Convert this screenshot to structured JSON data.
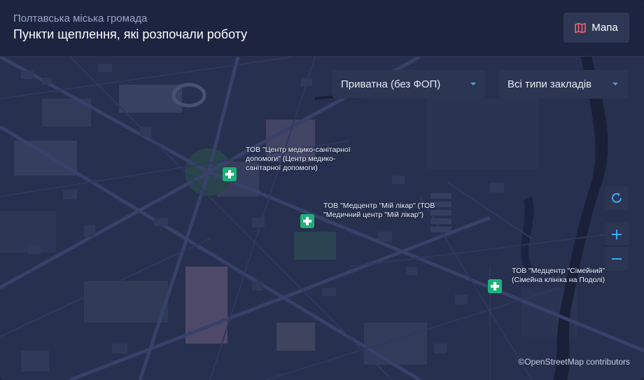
{
  "header": {
    "subtitle": "Полтавська міська громада",
    "title": "Пункти щеплення, які розпочали роботу",
    "map_button_label": "Мапа"
  },
  "filters": {
    "ownership": "Приватна (без ФОП)",
    "facility_type": "Всі типи закладів"
  },
  "markers": [
    {
      "icon": "medical-cross-icon",
      "label": "ТОВ \"Центр медико-санітарної допомоги\" (Центр медико-санітарної допомоги)"
    },
    {
      "icon": "medical-cross-icon",
      "label": "ТОВ \"Медцентр \"Мій лікар\" (ТОВ \"Медичний центр \"Мій лікар\")"
    },
    {
      "icon": "medical-cross-icon",
      "label": "ТОВ \"Медцентр \"Сімейний\" (Сімейна клініка на Подолі)"
    }
  ],
  "controls": {
    "refresh_icon": "refresh-icon",
    "zoom_in_icon": "plus-icon",
    "zoom_out_icon": "minus-icon"
  },
  "attribution": "©OpenStreetMap contributors",
  "colors": {
    "marker": "#20b07a",
    "accent": "#3fa9f5",
    "panel": "#1c2440",
    "map_base": "#2a3350"
  }
}
